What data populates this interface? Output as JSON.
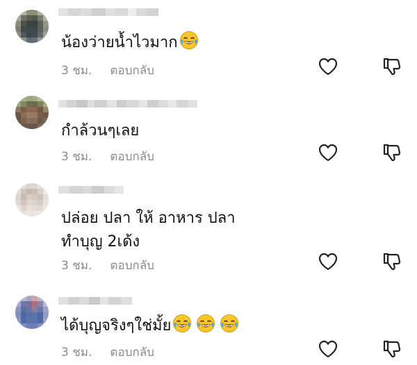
{
  "comments": [
    {
      "text": "น้องว่ายน้ำไวมาก",
      "emojis": [
        "face-with-tears-of-joy-icon"
      ],
      "time": "3 ชม.",
      "reply_label": "ตอบกลับ"
    },
    {
      "text": "กำล้วนๆเลย",
      "emojis": [],
      "time": "3 ชม.",
      "reply_label": "ตอบกลับ"
    },
    {
      "text": "ปล่อย ปลา ให้ อาหาร ปลา\nทำบุญ 2เด้ง",
      "emojis": [],
      "time": "3 ชม.",
      "reply_label": "ตอบกลับ"
    },
    {
      "text": "ได้บุญจริงๆใช่มั้ย",
      "emojis": [
        "face-with-tears-of-joy-icon",
        "face-with-tears-of-joy-icon",
        "face-with-tears-of-joy-icon"
      ],
      "time": "3 ชม.",
      "reply_label": "ตอบกลับ"
    }
  ],
  "icons": {
    "like": "heart-outline-icon",
    "dislike": "thumbs-down-outline-icon"
  },
  "colors": {
    "text": "#111111",
    "meta": "#8a8a8a",
    "icon": "#222222"
  }
}
